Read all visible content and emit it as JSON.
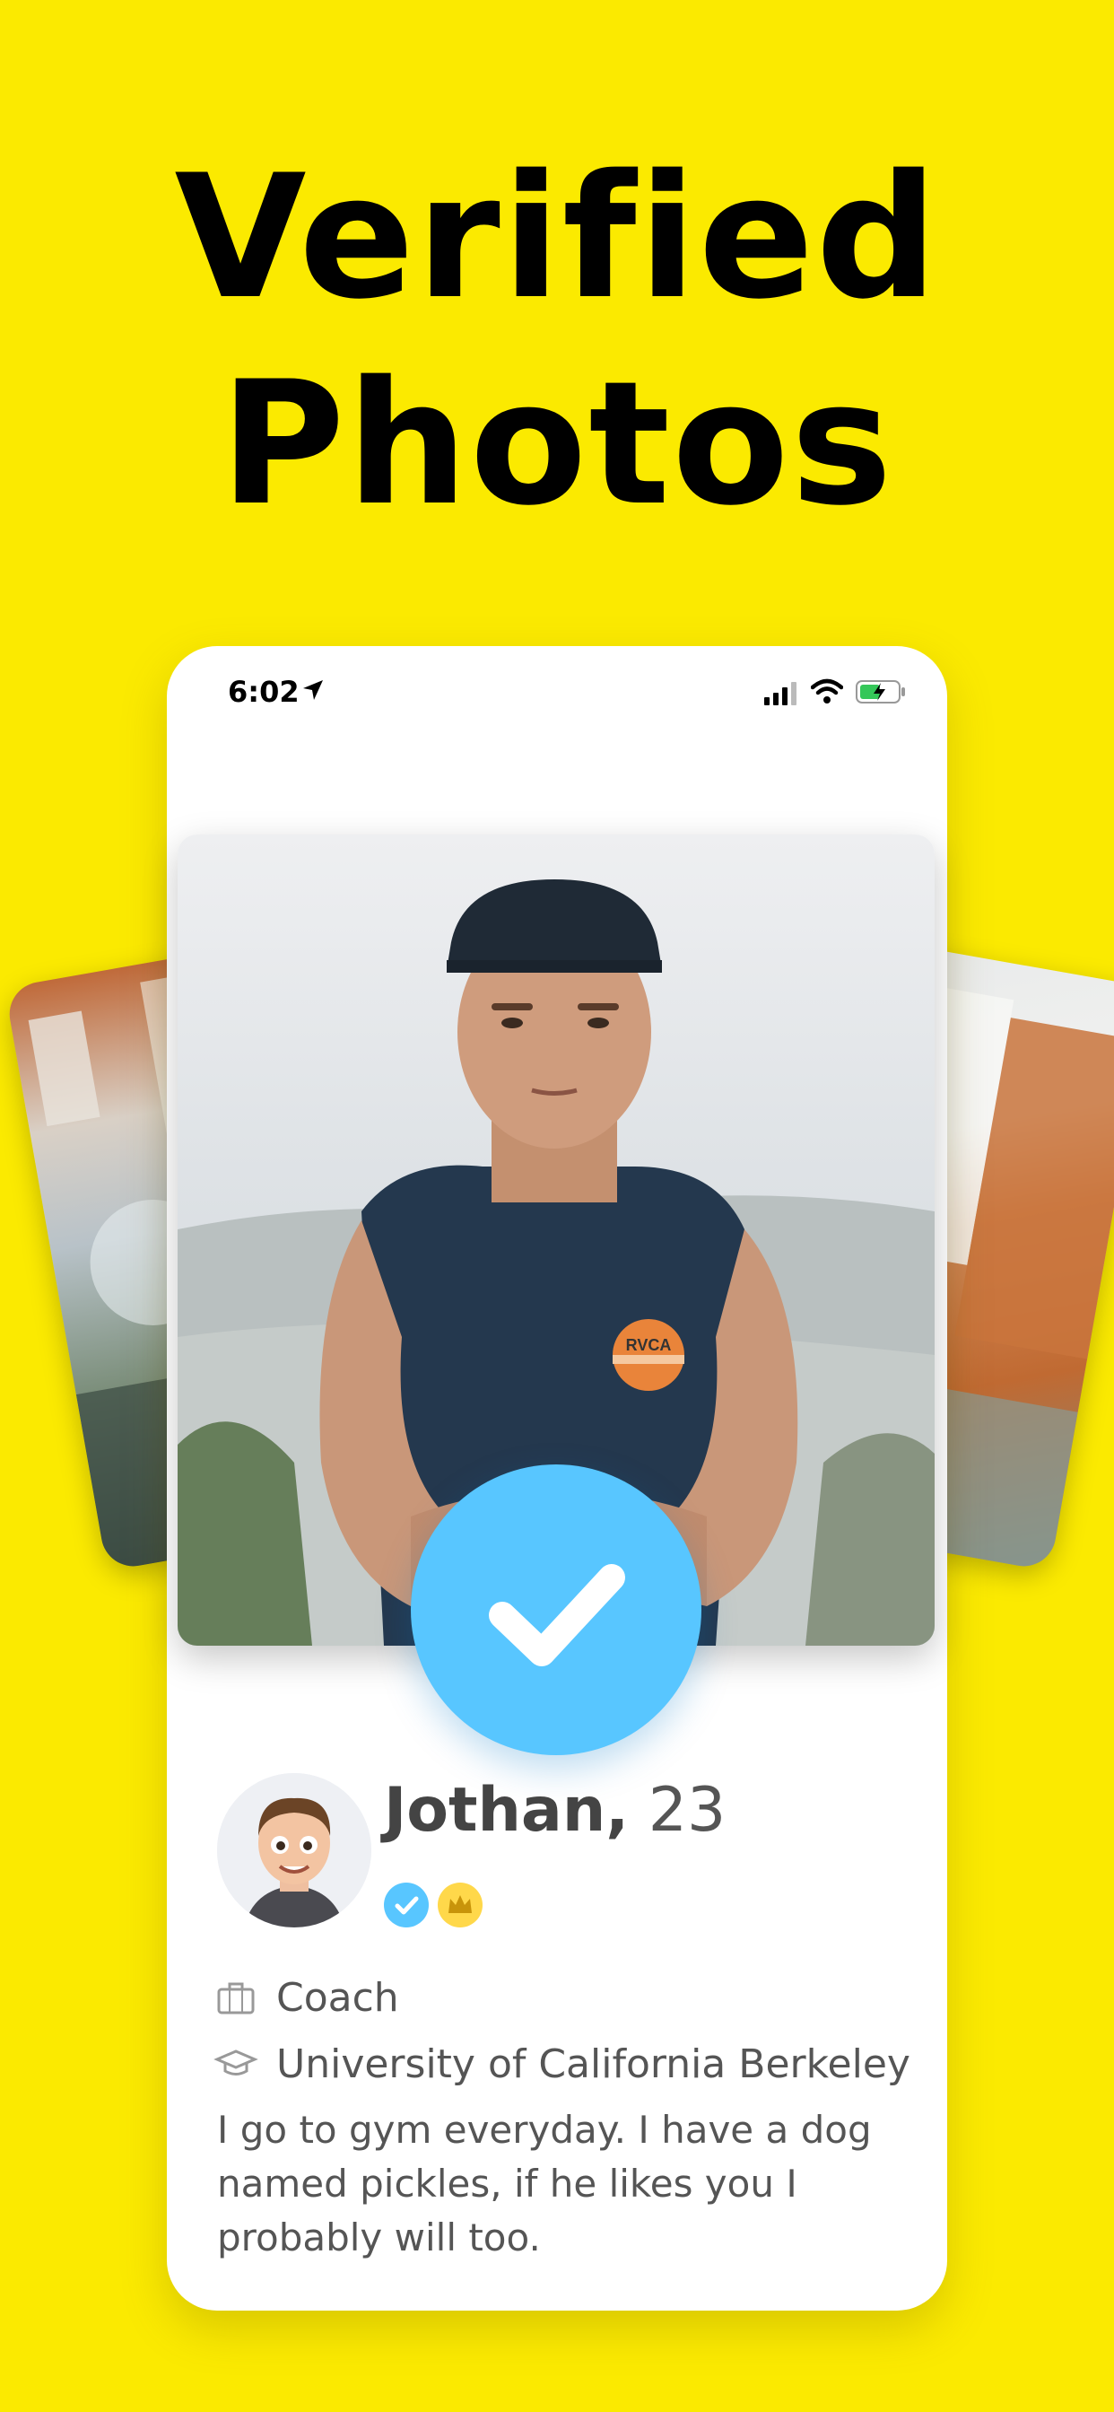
{
  "headline": {
    "line1": "Verified",
    "line2": "Photos"
  },
  "status_bar": {
    "time": "6:02"
  },
  "profile": {
    "name": "Jothan,",
    "age": "23",
    "job": "Coach",
    "school": "University of California Berkeley",
    "bio": "I go to gym everyday. I have a dog named pickles, if he likes you I probably will too.",
    "shirt_logo": "RVCA"
  },
  "icons": {
    "location": "location-arrow-icon",
    "signal": "signal-bars-icon",
    "wifi": "wifi-icon",
    "battery": "battery-charging-icon",
    "verified_check": "checkmark-icon",
    "verified_badge": "verified-badge-icon",
    "crown_badge": "crown-icon",
    "job": "briefcase-icon",
    "school": "graduation-cap-icon"
  },
  "colors": {
    "background": "#fbea00",
    "check_circle": "#58c6ff",
    "crown_badge": "#ffd84a",
    "battery_fill": "#34c759"
  }
}
